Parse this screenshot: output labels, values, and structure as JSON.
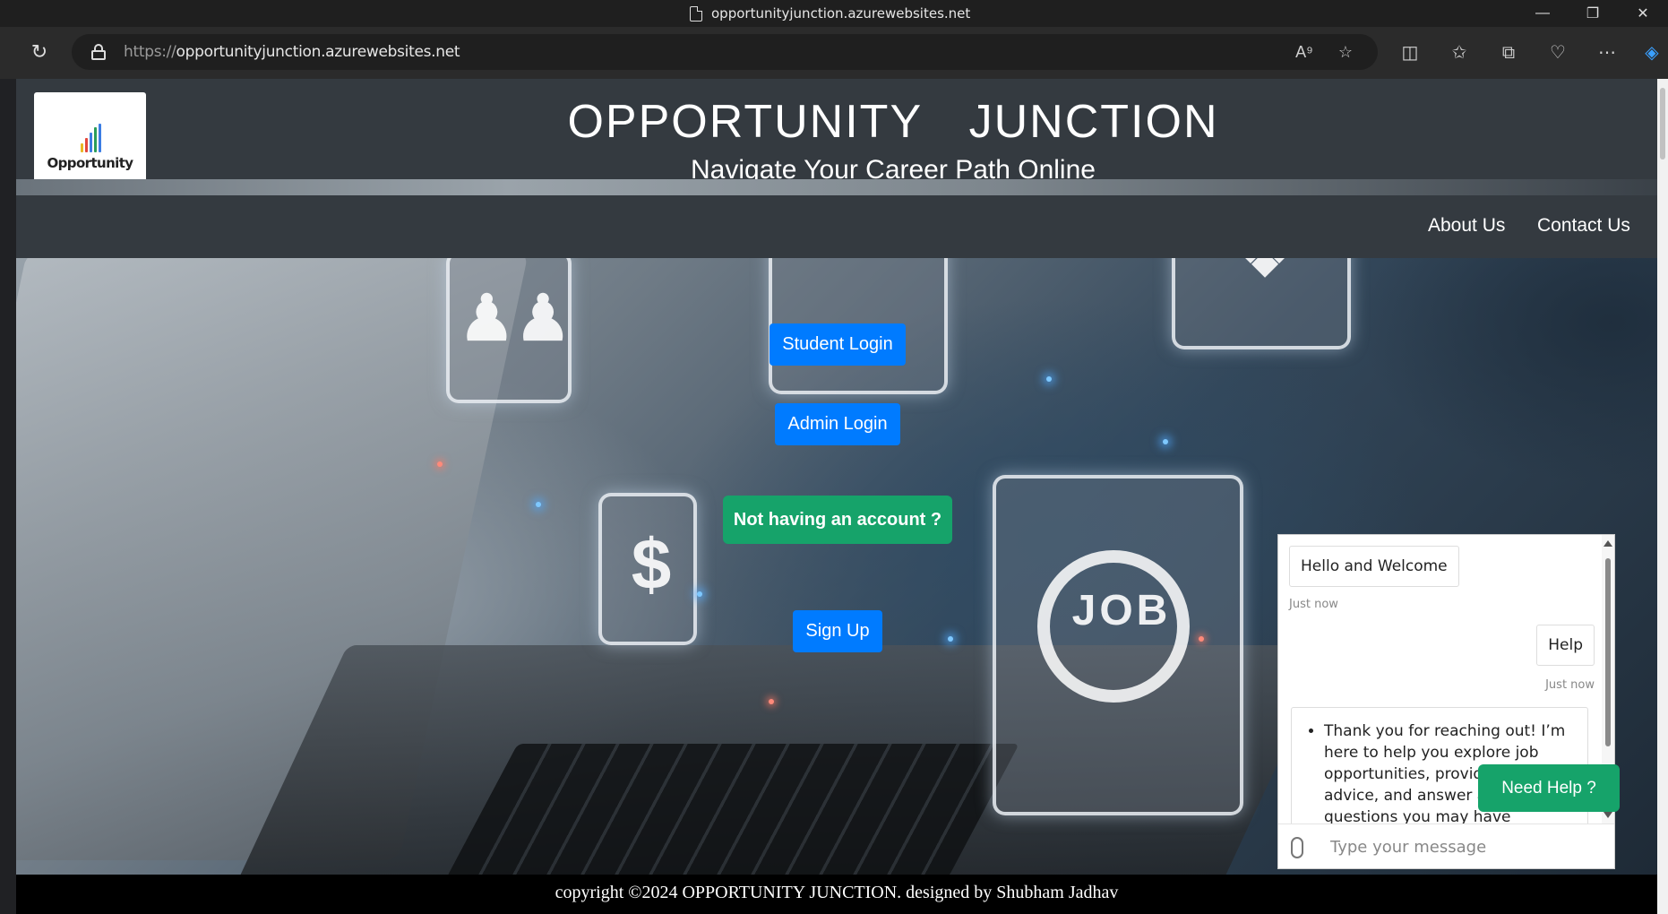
{
  "browser": {
    "tab_title": "opportunityjunction.azurewebsites.net",
    "url_scheme": "https://",
    "url_host": "opportunityjunction.azurewebsites.net",
    "window_controls": [
      "minimize",
      "restore",
      "close"
    ],
    "toolbar_icons": [
      "read-aloud-icon",
      "favorite-star-icon",
      "split-screen-icon",
      "favorites-icon",
      "collections-icon",
      "browser-essentials-icon",
      "more-icon",
      "copilot-icon"
    ]
  },
  "site": {
    "logo_text": "Opportunity",
    "title": "OPPORTUNITY JUNCTION",
    "subtitle": "Navigate Your Career Path Online"
  },
  "nav": {
    "about": "About Us",
    "contact": "Contact Us"
  },
  "hero": {
    "student_login": "Student Login",
    "admin_login": "Admin Login",
    "no_account": "Not having an account ?",
    "sign_up": "Sign Up",
    "card_glyphs": {
      "dollar": "$",
      "job": "JOB"
    }
  },
  "footer": {
    "text": "copyright ©2024 OPPORTUNITY JUNCTION. designed by Shubham Jadhav"
  },
  "chat": {
    "messages": [
      {
        "from": "bot",
        "text": "Hello and Welcome",
        "time": "Just now"
      },
      {
        "from": "user",
        "text": "Help",
        "time": "Just now"
      }
    ],
    "bot_reply": "Thank you for reaching out! I’m here to help you explore job opportunities, provide career advice, and answer any questions you may have",
    "input_placeholder": "Type your message",
    "need_help": "Need Help ?"
  },
  "colors": {
    "header_bg": "#343a40",
    "primary": "#007bff",
    "success": "#16a36a"
  }
}
